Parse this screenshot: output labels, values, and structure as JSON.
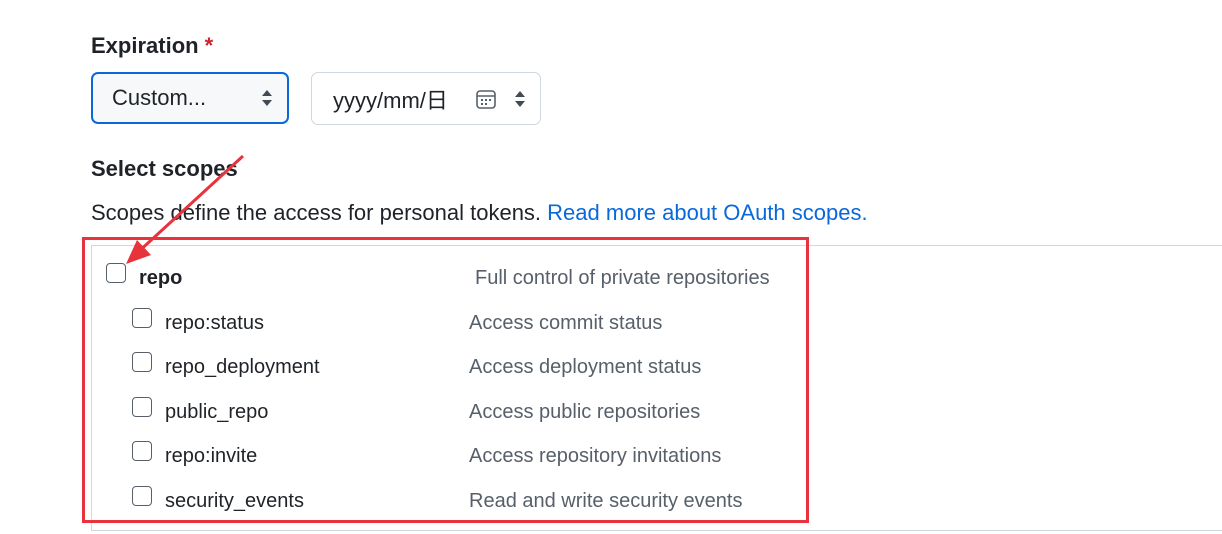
{
  "expiration": {
    "label": "Expiration",
    "required_mark": "*",
    "selected_option": "Custom...",
    "date_placeholder": "yyyy/mm/日"
  },
  "scopes": {
    "heading": "Select scopes",
    "description": "Scopes define the access for personal tokens.",
    "link_text": "Read more about OAuth scopes.",
    "items": [
      {
        "name": "repo",
        "description": "Full control of private repositories",
        "checked": false
      },
      {
        "name": "repo:status",
        "description": "Access commit status",
        "checked": false
      },
      {
        "name": "repo_deployment",
        "description": "Access deployment status",
        "checked": false
      },
      {
        "name": "public_repo",
        "description": "Access public repositories",
        "checked": false
      },
      {
        "name": "repo:invite",
        "description": "Access repository invitations",
        "checked": false
      },
      {
        "name": "security_events",
        "description": "Read and write security events",
        "checked": false
      }
    ]
  },
  "colors": {
    "accent": "#0969da",
    "required": "#cf222e",
    "annotation": "#e8323c",
    "border": "#d0d7de",
    "muted_text": "#57606a"
  },
  "icons": {
    "select_arrows": "chevron-up-down-icon",
    "calendar": "calendar-icon",
    "annotation_arrow": "arrow-icon"
  }
}
